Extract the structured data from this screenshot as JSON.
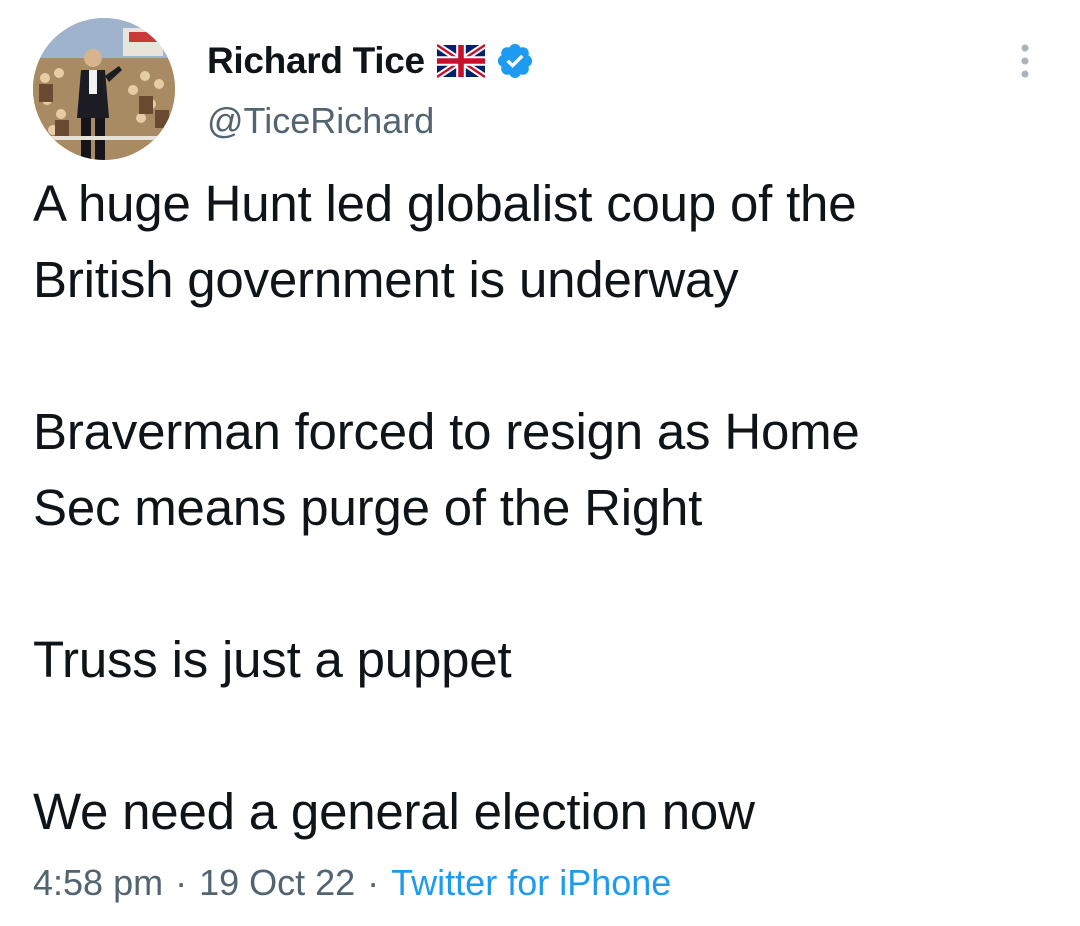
{
  "author": {
    "display_name": "Richard Tice",
    "handle": "@TiceRichard",
    "avatar_icon": "profile-photo",
    "flag_icon": "union-jack-flag-icon",
    "verified_icon": "verified-badge-icon"
  },
  "tweet": {
    "paragraphs": [
      "A huge Hunt led globalist coup of the\nBritish government is underway",
      "Braverman forced to resign as Home\nSec means purge of the Right",
      "Truss is just a puppet",
      "We need a general election now"
    ],
    "time": "4:58 pm",
    "date": "19 Oct 22",
    "separator": "·",
    "source": "Twitter for iPhone"
  },
  "colors": {
    "text": "#0f1419",
    "secondary": "#536471",
    "accent": "#1d9bf0",
    "background": "#ffffff"
  },
  "icons": {
    "more": "more-vertical-icon"
  }
}
